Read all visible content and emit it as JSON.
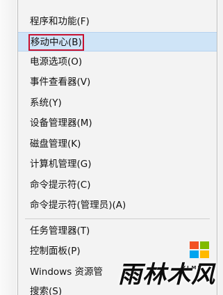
{
  "menu": {
    "items": [
      {
        "label": "程序和功能(F)"
      },
      {
        "label": "移动中心(B)",
        "highlighted": true,
        "boxed": true
      },
      {
        "label": "电源选项(O)"
      },
      {
        "label": "事件查看器(V)"
      },
      {
        "label": "系统(Y)"
      },
      {
        "label": "设备管理器(M)"
      },
      {
        "label": "磁盘管理(K)"
      },
      {
        "label": "计算机管理(G)"
      },
      {
        "label": "命令提示符(C)"
      },
      {
        "label": "命令提示符(管理员)(A)"
      },
      {
        "label": "任务管理器(T)"
      },
      {
        "label": "控制面板(P)"
      },
      {
        "label": "Windows 资源管"
      },
      {
        "label": "搜索(S)"
      }
    ]
  },
  "watermark": {
    "text": "雨林木风",
    "subtext": "YLMF",
    "logo_colors": [
      "#f25022",
      "#7fba00",
      "#00a4ef",
      "#ffb900"
    ]
  },
  "colors": {
    "highlight_bg": "#cfe4f7",
    "annotation_box": "#c8102e",
    "menu_bg": "#f3f3f3"
  }
}
